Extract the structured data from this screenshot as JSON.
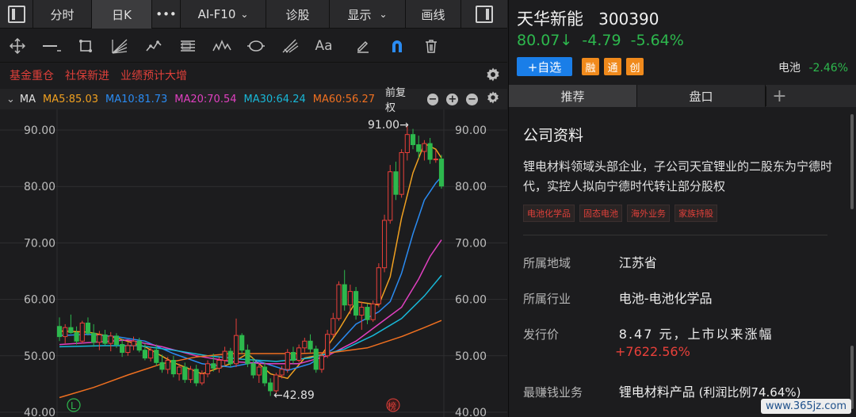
{
  "topbar": {
    "tabs": [
      {
        "label": "分时",
        "active": false
      },
      {
        "label": "日K",
        "active": true
      },
      {
        "label": "•••",
        "active": false
      },
      {
        "label": "AI-F10",
        "active": false
      },
      {
        "label": "诊股",
        "active": false
      },
      {
        "label": "显示",
        "active": false
      },
      {
        "label": "画线",
        "active": false
      }
    ]
  },
  "toolbar": {
    "icons": [
      "crosshair-icon",
      "line-icon",
      "crop-icon",
      "fan-icon",
      "wave-icon",
      "channel-icon",
      "zigzag-icon",
      "cycle-icon",
      "fib-icon",
      "text-icon",
      "pen-icon",
      "magnet-icon",
      "trash-icon"
    ],
    "text_icon_label": "Aa"
  },
  "tags": [
    "基金重仓",
    "社保新进",
    "业绩预计大增"
  ],
  "ma_bar": {
    "label": "MA",
    "ma5": "MA5:85.03",
    "ma10": "MA10:81.73",
    "ma20": "MA20:70.54",
    "ma30": "MA30:64.24",
    "ma60": "MA60:56.27",
    "adjust": "前复权",
    "colors": {
      "ma5": "#f0a020",
      "ma10": "#2a8bf2",
      "ma20": "#e040c0",
      "ma30": "#18b8d8",
      "ma60": "#f07020"
    }
  },
  "stock": {
    "name": "天华新能",
    "code": "300390",
    "price": "80.07↓",
    "change": "-4.79",
    "change_pct": "-5.64%",
    "add_label": "+自选",
    "badges": [
      "融",
      "通",
      "创"
    ],
    "sector_name": "电池",
    "sector_change": "-2.46%"
  },
  "tabs": [
    {
      "label": "推荐",
      "active": true
    },
    {
      "label": "盘口",
      "active": false
    },
    {
      "label": "+",
      "active": false
    }
  ],
  "profile": {
    "title": "公司资料",
    "desc": "锂电材料领域头部企业，子公司天宜锂业的二股东为宁德时代，实控人拟向宁德时代转让部分股权",
    "chips": [
      "电池化学品",
      "固态电池",
      "海外业务",
      "家族持股"
    ],
    "rows": [
      {
        "key": "所属地域",
        "value": "江苏省"
      },
      {
        "key": "所属行业",
        "value": "电池-电池化学品"
      },
      {
        "key": "发行价",
        "value": "8.47 元，上市以来涨幅",
        "value2": "+7622.56%"
      },
      {
        "key": "最赚钱业务",
        "value": "锂电材料产品",
        "value2": "(利润比例74.64%)"
      }
    ]
  },
  "watermark": "www.365jz.com",
  "chart_data": {
    "type": "candlestick",
    "ylim": [
      40,
      93
    ],
    "y_ticks": [
      "90.00",
      "80.00",
      "70.00",
      "60.00",
      "50.00",
      "40.00"
    ],
    "high_label": "91.00→",
    "low_label": "←42.89",
    "left_badge": "L",
    "right_badge": "榜",
    "up_color": "#e8403a",
    "down_color": "#2db84d",
    "candles": [
      {
        "o": 55.2,
        "h": 56.8,
        "l": 52.6,
        "c": 53.4
      },
      {
        "o": 53.4,
        "h": 55.6,
        "l": 52.2,
        "c": 55.0
      },
      {
        "o": 55.0,
        "h": 57.3,
        "l": 53.9,
        "c": 54.1
      },
      {
        "o": 54.1,
        "h": 55.2,
        "l": 52.0,
        "c": 52.6
      },
      {
        "o": 52.6,
        "h": 56.2,
        "l": 52.2,
        "c": 55.8
      },
      {
        "o": 55.8,
        "h": 56.8,
        "l": 53.6,
        "c": 54.0
      },
      {
        "o": 54.0,
        "h": 55.6,
        "l": 51.6,
        "c": 52.4
      },
      {
        "o": 52.4,
        "h": 54.4,
        "l": 51.0,
        "c": 53.7
      },
      {
        "o": 53.7,
        "h": 54.6,
        "l": 51.8,
        "c": 52.2
      },
      {
        "o": 52.2,
        "h": 54.2,
        "l": 50.8,
        "c": 53.5
      },
      {
        "o": 53.5,
        "h": 54.0,
        "l": 51.4,
        "c": 52.0
      },
      {
        "o": 52.0,
        "h": 53.0,
        "l": 49.8,
        "c": 50.6
      },
      {
        "o": 50.6,
        "h": 52.4,
        "l": 50.0,
        "c": 51.8
      },
      {
        "o": 51.8,
        "h": 53.4,
        "l": 51.0,
        "c": 52.6
      },
      {
        "o": 52.6,
        "h": 53.2,
        "l": 50.6,
        "c": 51.0
      },
      {
        "o": 51.0,
        "h": 52.2,
        "l": 49.2,
        "c": 49.6
      },
      {
        "o": 49.6,
        "h": 51.6,
        "l": 49.0,
        "c": 51.0
      },
      {
        "o": 51.0,
        "h": 52.0,
        "l": 48.2,
        "c": 48.8
      },
      {
        "o": 48.8,
        "h": 50.2,
        "l": 47.0,
        "c": 47.6
      },
      {
        "o": 47.6,
        "h": 49.8,
        "l": 46.8,
        "c": 49.2
      },
      {
        "o": 49.2,
        "h": 50.0,
        "l": 46.2,
        "c": 46.8
      },
      {
        "o": 46.8,
        "h": 48.6,
        "l": 45.6,
        "c": 48.0
      },
      {
        "o": 48.0,
        "h": 48.8,
        "l": 45.2,
        "c": 45.8
      },
      {
        "o": 45.8,
        "h": 48.2,
        "l": 45.2,
        "c": 47.6
      },
      {
        "o": 47.6,
        "h": 48.4,
        "l": 44.6,
        "c": 45.2
      },
      {
        "o": 45.2,
        "h": 47.4,
        "l": 44.8,
        "c": 46.8
      },
      {
        "o": 46.8,
        "h": 49.2,
        "l": 46.2,
        "c": 48.6
      },
      {
        "o": 48.6,
        "h": 50.4,
        "l": 47.2,
        "c": 47.8
      },
      {
        "o": 47.8,
        "h": 49.8,
        "l": 47.0,
        "c": 49.2
      },
      {
        "o": 49.2,
        "h": 51.6,
        "l": 48.4,
        "c": 50.8
      },
      {
        "o": 50.8,
        "h": 51.4,
        "l": 48.0,
        "c": 48.6
      },
      {
        "o": 48.6,
        "h": 56.6,
        "l": 48.0,
        "c": 53.6
      },
      {
        "o": 53.6,
        "h": 54.0,
        "l": 50.4,
        "c": 51.0
      },
      {
        "o": 51.0,
        "h": 52.0,
        "l": 48.0,
        "c": 48.6
      },
      {
        "o": 48.6,
        "h": 49.6,
        "l": 46.0,
        "c": 46.6
      },
      {
        "o": 46.6,
        "h": 48.6,
        "l": 45.2,
        "c": 48.0
      },
      {
        "o": 48.0,
        "h": 48.8,
        "l": 44.6,
        "c": 45.2
      },
      {
        "o": 45.2,
        "h": 46.0,
        "l": 42.89,
        "c": 43.8
      },
      {
        "o": 43.8,
        "h": 47.0,
        "l": 43.4,
        "c": 46.6
      },
      {
        "o": 46.6,
        "h": 48.2,
        "l": 46.0,
        "c": 47.6
      },
      {
        "o": 47.6,
        "h": 51.2,
        "l": 47.0,
        "c": 50.6
      },
      {
        "o": 50.6,
        "h": 51.6,
        "l": 48.6,
        "c": 49.2
      },
      {
        "o": 49.2,
        "h": 52.0,
        "l": 48.8,
        "c": 51.4
      },
      {
        "o": 51.4,
        "h": 53.2,
        "l": 50.6,
        "c": 52.6
      },
      {
        "o": 52.6,
        "h": 53.8,
        "l": 50.6,
        "c": 51.2
      },
      {
        "o": 51.2,
        "h": 51.8,
        "l": 47.0,
        "c": 47.6
      },
      {
        "o": 47.6,
        "h": 50.6,
        "l": 47.0,
        "c": 50.0
      },
      {
        "o": 50.0,
        "h": 54.6,
        "l": 49.6,
        "c": 53.8
      },
      {
        "o": 53.8,
        "h": 57.6,
        "l": 53.2,
        "c": 56.6
      },
      {
        "o": 56.6,
        "h": 63.2,
        "l": 56.2,
        "c": 62.6
      },
      {
        "o": 62.6,
        "h": 65.2,
        "l": 58.0,
        "c": 59.0
      },
      {
        "o": 59.0,
        "h": 62.6,
        "l": 57.4,
        "c": 61.4
      },
      {
        "o": 61.4,
        "h": 62.2,
        "l": 56.4,
        "c": 57.2
      },
      {
        "o": 57.2,
        "h": 59.6,
        "l": 54.6,
        "c": 58.6
      },
      {
        "o": 58.6,
        "h": 59.2,
        "l": 55.6,
        "c": 56.4
      },
      {
        "o": 56.4,
        "h": 59.8,
        "l": 56.0,
        "c": 59.2
      },
      {
        "o": 59.2,
        "h": 66.4,
        "l": 58.6,
        "c": 65.6
      },
      {
        "o": 65.6,
        "h": 75.0,
        "l": 64.8,
        "c": 74.0
      },
      {
        "o": 74.0,
        "h": 83.8,
        "l": 73.4,
        "c": 82.6
      },
      {
        "o": 82.6,
        "h": 84.4,
        "l": 77.6,
        "c": 78.6
      },
      {
        "o": 78.6,
        "h": 86.6,
        "l": 78.0,
        "c": 86.0
      },
      {
        "o": 86.0,
        "h": 91.0,
        "l": 84.6,
        "c": 89.2
      },
      {
        "o": 89.2,
        "h": 90.2,
        "l": 86.6,
        "c": 87.4
      },
      {
        "o": 87.4,
        "h": 89.0,
        "l": 85.0,
        "c": 86.2
      },
      {
        "o": 86.2,
        "h": 88.2,
        "l": 84.6,
        "c": 87.6
      },
      {
        "o": 87.6,
        "h": 88.6,
        "l": 84.0,
        "c": 84.8
      },
      {
        "o": 84.8,
        "h": 86.4,
        "l": 84.2,
        "c": 84.86
      },
      {
        "o": 84.86,
        "h": 85.6,
        "l": 79.6,
        "c": 80.07
      }
    ],
    "ma_lines": {
      "ma5": [
        [
          0,
          54.4
        ],
        [
          5,
          54.2
        ],
        [
          10,
          53.2
        ],
        [
          15,
          51.6
        ],
        [
          20,
          48.8
        ],
        [
          25,
          46.8
        ],
        [
          30,
          48.6
        ],
        [
          33,
          50.4
        ],
        [
          37,
          46.8
        ],
        [
          40,
          46.0
        ],
        [
          43,
          49.6
        ],
        [
          46,
          50.2
        ],
        [
          49,
          54.6
        ],
        [
          52,
          59.6
        ],
        [
          56,
          59.0
        ],
        [
          58,
          64.0
        ],
        [
          60,
          74.4
        ],
        [
          62,
          82.4
        ],
        [
          64,
          87.6
        ],
        [
          66,
          86.6
        ],
        [
          67,
          85.03
        ]
      ],
      "ma10": [
        [
          0,
          53.6
        ],
        [
          5,
          53.8
        ],
        [
          10,
          53.4
        ],
        [
          15,
          52.6
        ],
        [
          20,
          50.4
        ],
        [
          25,
          48.6
        ],
        [
          30,
          48.0
        ],
        [
          35,
          49.0
        ],
        [
          40,
          47.4
        ],
        [
          44,
          48.6
        ],
        [
          48,
          51.2
        ],
        [
          52,
          55.6
        ],
        [
          56,
          57.8
        ],
        [
          58,
          59.6
        ],
        [
          60,
          64.6
        ],
        [
          62,
          71.6
        ],
        [
          64,
          77.6
        ],
        [
          66,
          80.6
        ],
        [
          67,
          81.73
        ]
      ],
      "ma20": [
        [
          0,
          52.0
        ],
        [
          6,
          52.4
        ],
        [
          12,
          52.8
        ],
        [
          18,
          51.6
        ],
        [
          24,
          50.0
        ],
        [
          30,
          49.0
        ],
        [
          36,
          48.6
        ],
        [
          42,
          48.6
        ],
        [
          47,
          50.0
        ],
        [
          52,
          52.6
        ],
        [
          56,
          55.6
        ],
        [
          60,
          58.6
        ],
        [
          63,
          63.6
        ],
        [
          65,
          67.6
        ],
        [
          67,
          70.54
        ]
      ],
      "ma30": [
        [
          0,
          51.6
        ],
        [
          8,
          51.8
        ],
        [
          14,
          51.8
        ],
        [
          20,
          51.0
        ],
        [
          26,
          50.0
        ],
        [
          32,
          49.4
        ],
        [
          38,
          49.0
        ],
        [
          44,
          49.6
        ],
        [
          50,
          51.2
        ],
        [
          55,
          53.6
        ],
        [
          60,
          56.6
        ],
        [
          64,
          60.6
        ],
        [
          67,
          64.24
        ]
      ],
      "ma60": [
        [
          0,
          42.6
        ],
        [
          6,
          44.4
        ],
        [
          12,
          46.6
        ],
        [
          18,
          48.6
        ],
        [
          24,
          49.8
        ],
        [
          30,
          50.4
        ],
        [
          36,
          50.4
        ],
        [
          42,
          50.4
        ],
        [
          48,
          50.6
        ],
        [
          54,
          51.4
        ],
        [
          60,
          53.4
        ],
        [
          64,
          55.0
        ],
        [
          67,
          56.27
        ]
      ]
    }
  }
}
